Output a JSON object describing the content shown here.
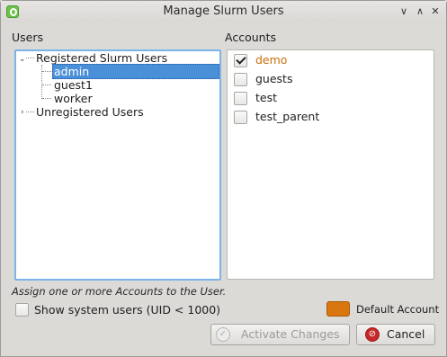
{
  "window": {
    "title": "Manage Slurm Users"
  },
  "users": {
    "label": "Users",
    "tree": [
      {
        "label": "Registered Slurm Users",
        "children": [
          "admin",
          "guest1",
          "worker"
        ],
        "selected": "admin"
      },
      {
        "label": "Unregistered Users"
      }
    ]
  },
  "accounts": {
    "label": "Accounts",
    "items": [
      {
        "label": "demo",
        "checked": true,
        "default": true
      },
      {
        "label": "guests",
        "checked": false
      },
      {
        "label": "test",
        "checked": false
      },
      {
        "label": "test_parent",
        "checked": false
      }
    ]
  },
  "hint": "Assign one or more Accounts to the User.",
  "show_system_users": {
    "label": "Show system users (UID < 1000)",
    "checked": false
  },
  "legend": {
    "label": "Default Account",
    "color": "#d9760f"
  },
  "buttons": {
    "activate": "Activate Changes",
    "cancel": "Cancel"
  }
}
